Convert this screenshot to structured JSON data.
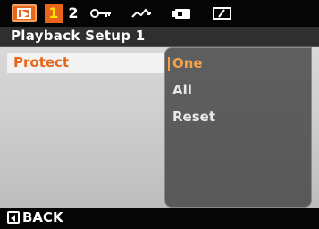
{
  "tabs": {
    "playback_icon": "playback-icon",
    "tab1_label": "1",
    "tab2_label": "2",
    "icons": [
      "key-icon",
      "wave-icon",
      "tools-icon",
      "battery-icon"
    ]
  },
  "header": {
    "title": "Playback Setup 1"
  },
  "menu": {
    "selected_item": "Protect"
  },
  "submenu": {
    "options": [
      "One",
      "All",
      "Reset"
    ],
    "selected_index": 0
  },
  "footer": {
    "back_label": "BACK"
  },
  "colors": {
    "accent": "#e8661b",
    "highlight": "#f3a24a",
    "tab_number": "#ffe600"
  }
}
